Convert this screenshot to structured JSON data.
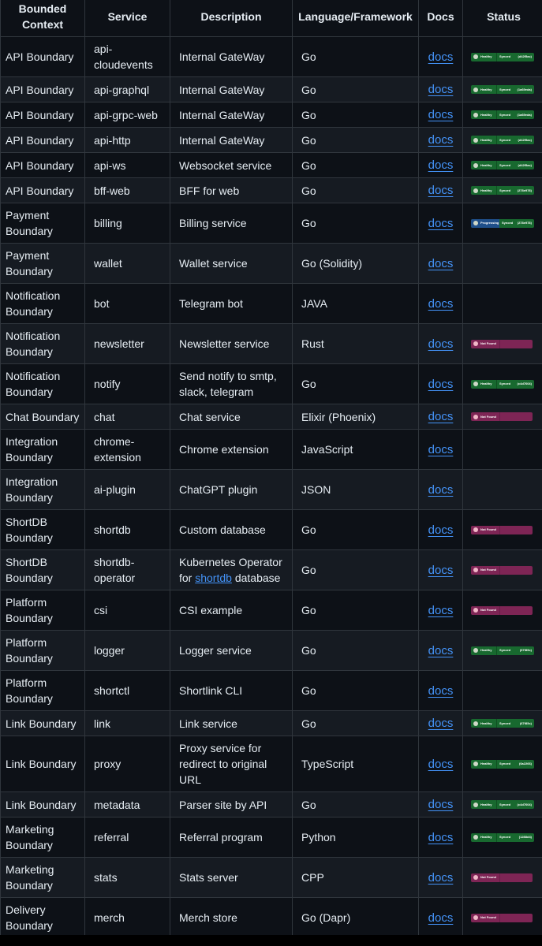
{
  "table": {
    "headers": [
      "Bounded Context",
      "Service",
      "Description",
      "Language/Framework",
      "Docs",
      "Status"
    ],
    "rows": [
      {
        "context": "API Boundary",
        "service": "api-cloudevents",
        "description": "Internal GateWay",
        "language": "Go",
        "docs": "docs",
        "status": {
          "type": "healthy",
          "health": "Healthy",
          "sync": "Synced",
          "revision": "(d42f5ac)"
        }
      },
      {
        "context": "API Boundary",
        "service": "api-graphql",
        "description": "Internal GateWay",
        "language": "Go",
        "docs": "docs",
        "status": {
          "type": "healthy",
          "health": "Healthy",
          "sync": "Synced",
          "revision": "(1a69eda)"
        }
      },
      {
        "context": "API Boundary",
        "service": "api-grpc-web",
        "description": "Internal GateWay",
        "language": "Go",
        "docs": "docs",
        "status": {
          "type": "healthy",
          "health": "Healthy",
          "sync": "Synced",
          "revision": "(1a69eda)"
        }
      },
      {
        "context": "API Boundary",
        "service": "api-http",
        "description": "Internal GateWay",
        "language": "Go",
        "docs": "docs",
        "status": {
          "type": "healthy",
          "health": "Healthy",
          "sync": "Synced",
          "revision": "(d42f5ac)"
        }
      },
      {
        "context": "API Boundary",
        "service": "api-ws",
        "description": "Websocket service",
        "language": "Go",
        "docs": "docs",
        "status": {
          "type": "healthy",
          "health": "Healthy",
          "sync": "Synced",
          "revision": "(d42f5ac)"
        }
      },
      {
        "context": "API Boundary",
        "service": "bff-web",
        "description": "BFF for web",
        "language": "Go",
        "docs": "docs",
        "status": {
          "type": "healthy",
          "health": "Healthy",
          "sync": "Synced",
          "revision": "(278e978)"
        }
      },
      {
        "context": "Payment Boundary",
        "service": "billing",
        "description": "Billing service",
        "language": "Go",
        "docs": "docs",
        "status": {
          "type": "progressing",
          "health": "Progressing",
          "sync": "Synced",
          "revision": "(278e978)"
        }
      },
      {
        "context": "Payment Boundary",
        "service": "wallet",
        "description": "Wallet service",
        "language": "Go (Solidity)",
        "docs": "docs",
        "status": null
      },
      {
        "context": "Notification Boundary",
        "service": "bot",
        "description": "Telegram bot",
        "language": "JAVA",
        "docs": "docs",
        "status": null
      },
      {
        "context": "Notification Boundary",
        "service": "newsletter",
        "description": "Newsletter service",
        "language": "Rust",
        "docs": "docs",
        "status": {
          "type": "notfound",
          "health": "Not Found"
        }
      },
      {
        "context": "Notification Boundary",
        "service": "notify",
        "description": "Send notify to smtp, slack, telegram",
        "language": "Go",
        "docs": "docs",
        "status": {
          "type": "healthy",
          "health": "Healthy",
          "sync": "Synced",
          "revision": "(c4d7604)"
        }
      },
      {
        "context": "Chat Boundary",
        "service": "chat",
        "description": "Chat service",
        "language": "Elixir (Phoenix)",
        "docs": "docs",
        "status": {
          "type": "notfound",
          "health": "Not Found"
        }
      },
      {
        "context": "Integration Boundary",
        "service": "chrome-extension",
        "description": "Chrome extension",
        "language": "JavaScript",
        "docs": "docs",
        "status": null
      },
      {
        "context": "Integration Boundary",
        "service": "ai-plugin",
        "description": "ChatGPT plugin",
        "language": "JSON",
        "docs": "docs",
        "status": null
      },
      {
        "context": "ShortDB Boundary",
        "service": "shortdb",
        "description": "Custom database",
        "language": "Go",
        "docs": "docs",
        "status": {
          "type": "notfound",
          "health": "Not Found"
        }
      },
      {
        "context": "ShortDB Boundary",
        "service": "shortdb-operator",
        "description": "Kubernetes Operator for",
        "description_link": "shortdb",
        "description_tail": "database",
        "language": "Go",
        "docs": "docs",
        "status": {
          "type": "notfound",
          "health": "Not Found"
        }
      },
      {
        "context": "Platform Boundary",
        "service": "csi",
        "description": "CSI example",
        "language": "Go",
        "docs": "docs",
        "status": {
          "type": "notfound",
          "health": "Not Found"
        }
      },
      {
        "context": "Platform Boundary",
        "service": "logger",
        "description": "Logger service",
        "language": "Go",
        "docs": "docs",
        "status": {
          "type": "healthy",
          "health": "Healthy",
          "sync": "Synced",
          "revision": "(67f85c)"
        }
      },
      {
        "context": "Platform Boundary",
        "service": "shortctl",
        "description": "Shortlink CLI",
        "language": "Go",
        "docs": "docs",
        "status": null
      },
      {
        "context": "Link Boundary",
        "service": "link",
        "description": "Link service",
        "language": "Go",
        "docs": "docs",
        "status": {
          "type": "healthy",
          "health": "Healthy",
          "sync": "Synced",
          "revision": "(67f85c)"
        }
      },
      {
        "context": "Link Boundary",
        "service": "proxy",
        "description": "Proxy service for redirect to original URL",
        "language": "TypeScript",
        "docs": "docs",
        "status": {
          "type": "healthy",
          "health": "Healthy",
          "sync": "Synced",
          "revision": "(6a2266)"
        }
      },
      {
        "context": "Link Boundary",
        "service": "metadata",
        "description": "Parser site by API",
        "language": "Go",
        "docs": "docs",
        "status": {
          "type": "healthy",
          "health": "Healthy",
          "sync": "Synced",
          "revision": "(c4d7604)"
        }
      },
      {
        "context": "Marketing Boundary",
        "service": "referral",
        "description": "Referral program",
        "language": "Python",
        "docs": "docs",
        "status": {
          "type": "healthy",
          "health": "Healthy",
          "sync": "Synced",
          "revision": "(1288d4)"
        }
      },
      {
        "context": "Marketing Boundary",
        "service": "stats",
        "description": "Stats server",
        "language": "CPP",
        "docs": "docs",
        "status": {
          "type": "notfound",
          "health": "Not Found"
        }
      },
      {
        "context": "Delivery Boundary",
        "service": "merch",
        "description": "Merch store",
        "language": "Go (Dapr)",
        "docs": "docs",
        "status": {
          "type": "notfound",
          "health": "Not Found"
        }
      }
    ]
  },
  "colors": {
    "background": "#0d1117",
    "row_alt": "#161b22",
    "border": "#30363d",
    "link": "#4493f8",
    "healthy": "#18692f",
    "progressing": "#1f4f8a",
    "not_found": "#7e2555"
  }
}
